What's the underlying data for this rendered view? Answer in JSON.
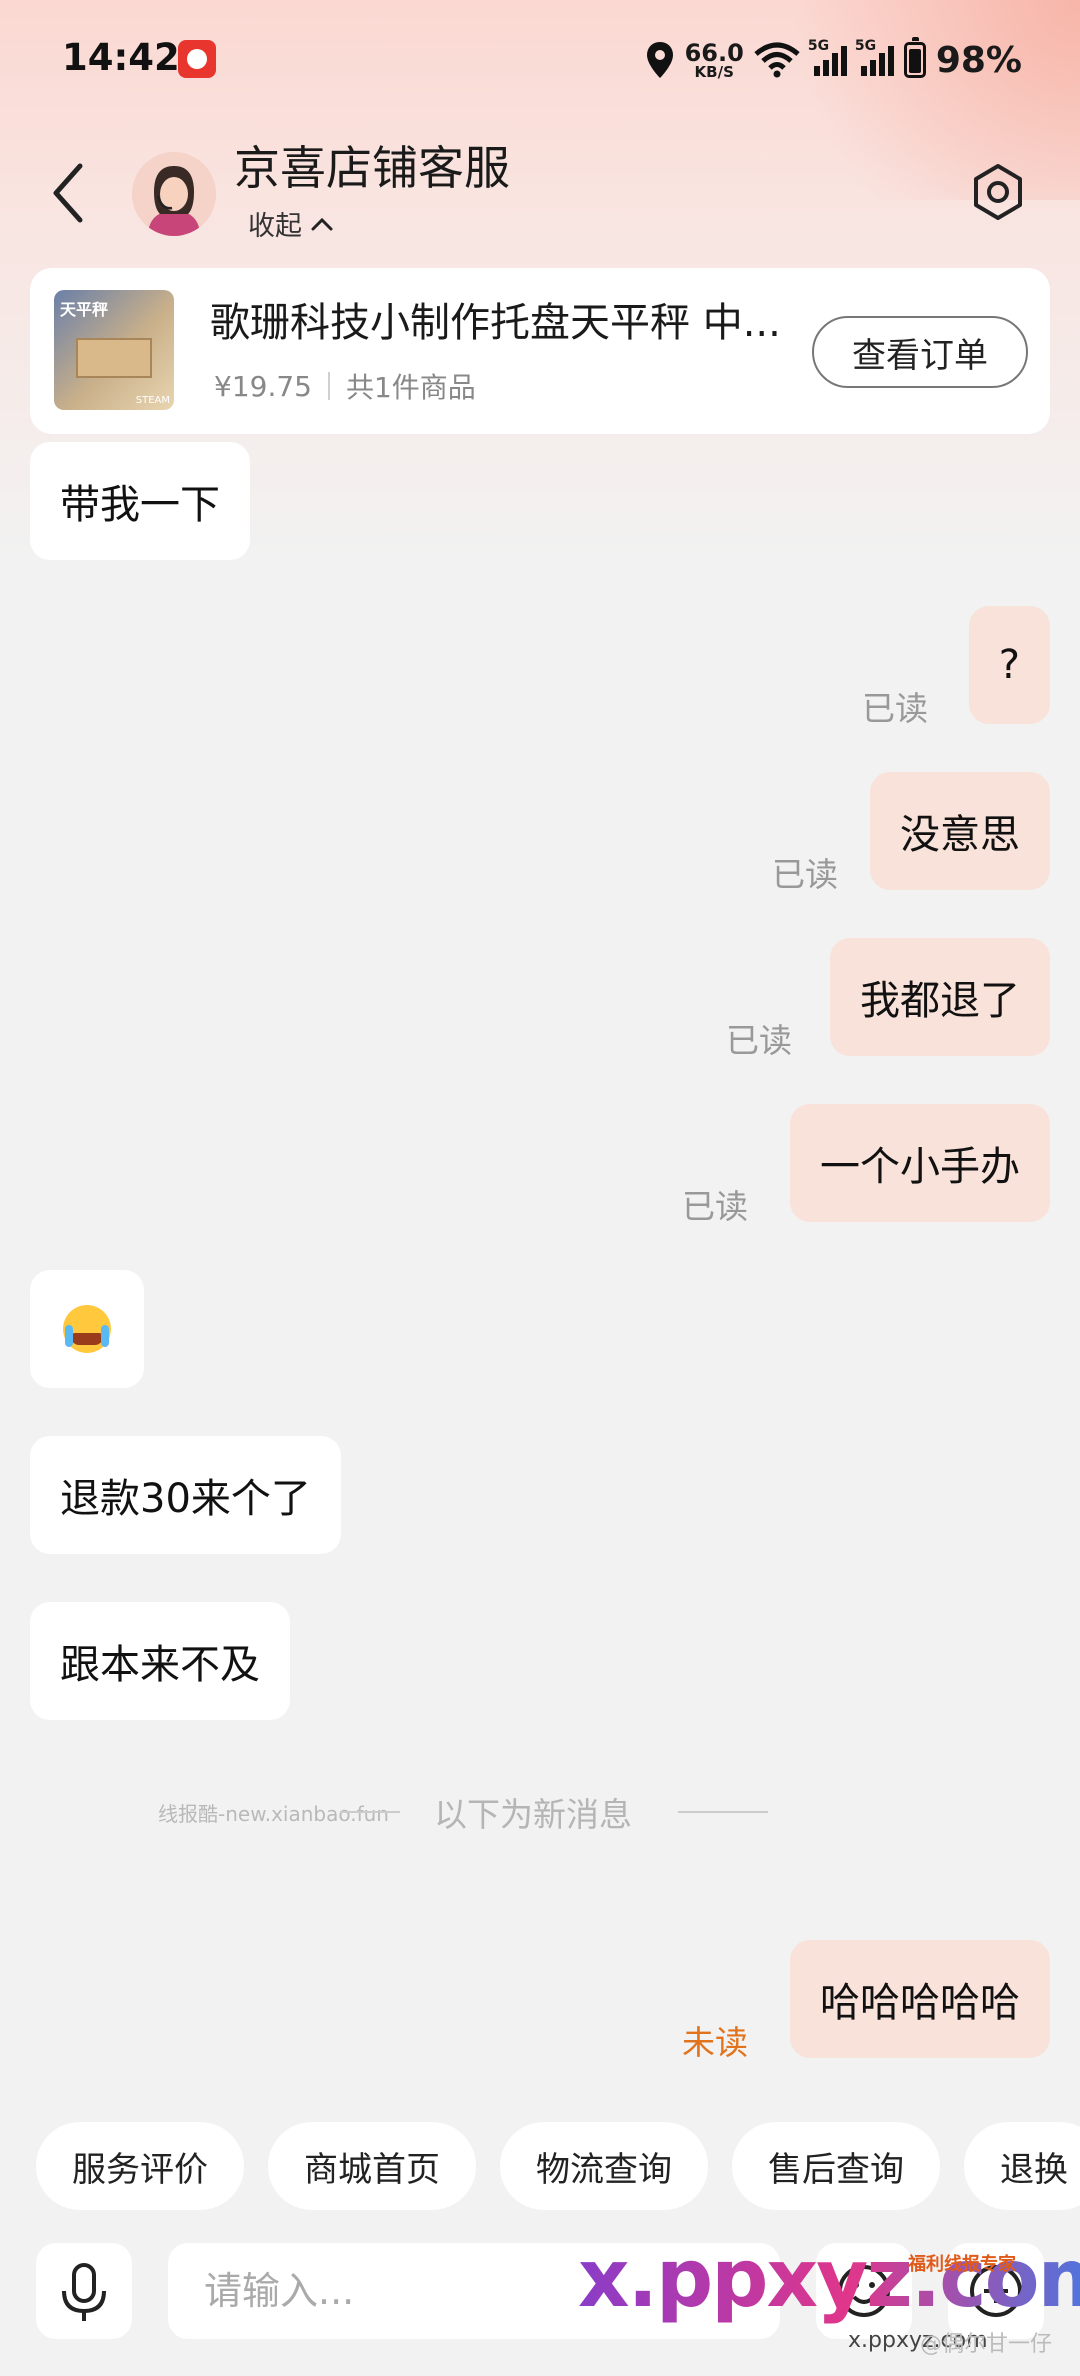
{
  "status_bar": {
    "time": "14:42",
    "net_speed_value": "66.0",
    "net_speed_unit": "KB/S",
    "signal_1": "5G",
    "signal_2": "5G",
    "battery": "98%"
  },
  "header": {
    "title": "京喜店铺客服",
    "collapse_label": "收起"
  },
  "order": {
    "thumb_label": "天平秤",
    "thumb_sub": "STEAM",
    "title": "歌珊科技小制作托盘天平秤 中...",
    "price": "¥19.75",
    "count": "共1件商品",
    "button": "查看订单"
  },
  "messages": [
    {
      "side": "left",
      "text": "带我一下"
    },
    {
      "side": "right",
      "text": "?",
      "status": "已读"
    },
    {
      "side": "right",
      "text": "没意思",
      "status": "已读"
    },
    {
      "side": "right",
      "text": "我都退了",
      "status": "已读"
    },
    {
      "side": "right",
      "text": "一个小手办",
      "status": "已读"
    },
    {
      "side": "left",
      "emoji": "loudly-crying-face"
    },
    {
      "side": "left",
      "text": "退款30来个了"
    },
    {
      "side": "left",
      "text": "跟本来不及"
    },
    {
      "side": "right",
      "text": "哈哈哈哈哈",
      "status": "未读"
    }
  ],
  "divider": {
    "watermark": "线报酷-new.xianbao.fun",
    "text": "以下为新消息"
  },
  "quick_chips": [
    "服务评价",
    "商城首页",
    "物流查询",
    "售后查询",
    "退换"
  ],
  "input": {
    "placeholder": "请输入..."
  },
  "watermarks": {
    "big": "x.ppxyz.com",
    "top": "福利线报专家",
    "bottom": "x.ppxyz.com",
    "author": "@偶尔甘一仔"
  },
  "colors": {
    "accent_unread": "#e2731d",
    "bubble_right": "#f9e2d9",
    "header_gradient": "#fbd8d2"
  }
}
